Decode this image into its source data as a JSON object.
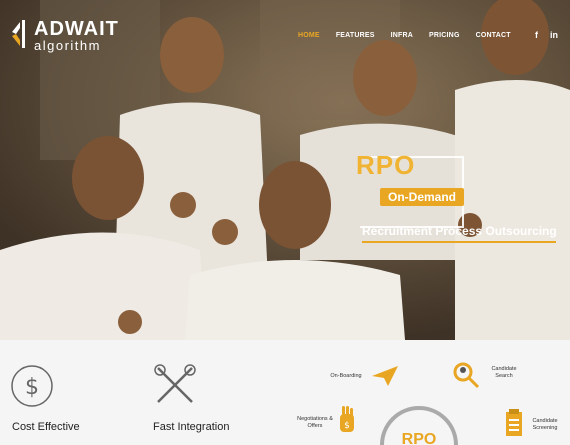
{
  "brand": {
    "name": "ADWAIT",
    "sub": "algorithm"
  },
  "nav": {
    "items": [
      "HOME",
      "FEATURES",
      "INFRA",
      "PRICING",
      "CONTACT"
    ],
    "active": "HOME",
    "social": [
      "f",
      "in"
    ]
  },
  "hero": {
    "rpo": "RPO",
    "on_demand": "On-Demand",
    "tagline": "Recruitment Process Outsourcing"
  },
  "features": [
    {
      "label": "Cost Effective",
      "icon": "dollar-circle-icon"
    },
    {
      "label": "Fast Integration",
      "icon": "tools-icon"
    }
  ],
  "process": {
    "onboarding": "On-Boarding",
    "candidate_search": "Candidate Search",
    "negotiations": "Negotiations & Offers",
    "candidate_screening": "Candidate Screening",
    "center": "RPO"
  },
  "colors": {
    "accent": "#e8a623",
    "hero_bg": "#5a4a38",
    "bottom_bg": "#f5f5f5"
  }
}
